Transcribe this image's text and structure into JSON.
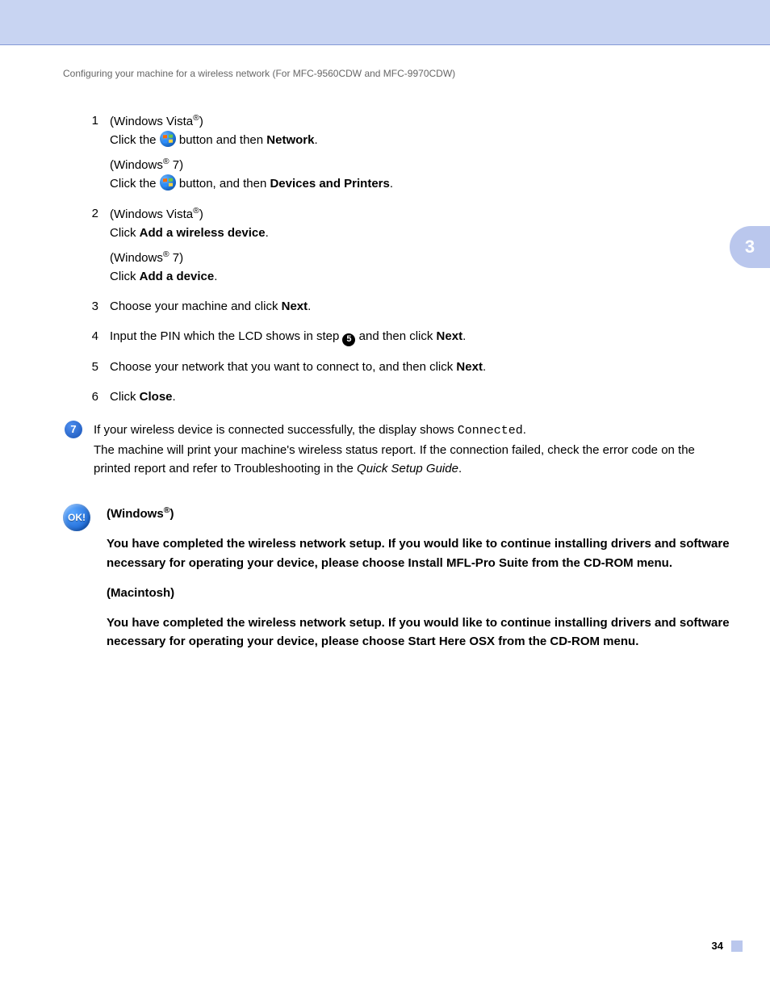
{
  "header": "Configuring your machine for a wireless network (For MFC-9560CDW and MFC-9970CDW)",
  "sideTab": "3",
  "pageNumber": "34",
  "steps": {
    "s1": {
      "num": "1",
      "vista_prefix": "(Windows Vista",
      "vista_suffix": ")",
      "vista_line_a": "Click the ",
      "vista_line_b": " button and then ",
      "vista_bold": "Network",
      "vista_end": ".",
      "win7_prefix": "(Windows",
      "win7_suffix": " 7)",
      "win7_line_a": "Click the ",
      "win7_line_b": " button, and then ",
      "win7_bold": "Devices and Printers",
      "win7_end": "."
    },
    "s2": {
      "num": "2",
      "vista_prefix": "(Windows Vista",
      "vista_suffix": ")",
      "vista_click": "Click ",
      "vista_bold": "Add a wireless device",
      "vista_end": ".",
      "win7_prefix": "(Windows",
      "win7_suffix": " 7)",
      "win7_click": "Click ",
      "win7_bold": "Add a device",
      "win7_end": "."
    },
    "s3": {
      "num": "3",
      "a": "Choose your machine and click ",
      "b": "Next",
      "c": "."
    },
    "s4": {
      "num": "4",
      "a": "Input the PIN which the LCD shows in step ",
      "ref": "5",
      "b": " and then click ",
      "c": "Next",
      "d": "."
    },
    "s5": {
      "num": "5",
      "a": "Choose your network that you want to connect to, and then click ",
      "b": "Next",
      "c": "."
    },
    "s6": {
      "num": "6",
      "a": "Click ",
      "b": "Close",
      "c": "."
    }
  },
  "step7": {
    "num": "7",
    "a": "If your wireless device is connected successfully, the display shows ",
    "mono": "Connected",
    "b": ".",
    "line2a": "The machine will print your machine's wireless status report. If the connection failed, check the error code on the printed report and refer to Troubleshooting in the ",
    "italic": "Quick Setup Guide",
    "line2b": "."
  },
  "ok": {
    "badge": "OK!",
    "win_heading_a": "(Windows",
    "win_heading_b": ")",
    "win_body": "You have completed the wireless network setup. If you would like to continue installing drivers and software necessary for operating your device, please choose Install MFL-Pro Suite from the CD-ROM menu.",
    "mac_heading": "(Macintosh)",
    "mac_body": "You have completed the wireless network setup. If you would like to continue installing drivers and software necessary for operating your device, please choose Start Here OSX from the CD-ROM menu."
  },
  "reg": "®"
}
